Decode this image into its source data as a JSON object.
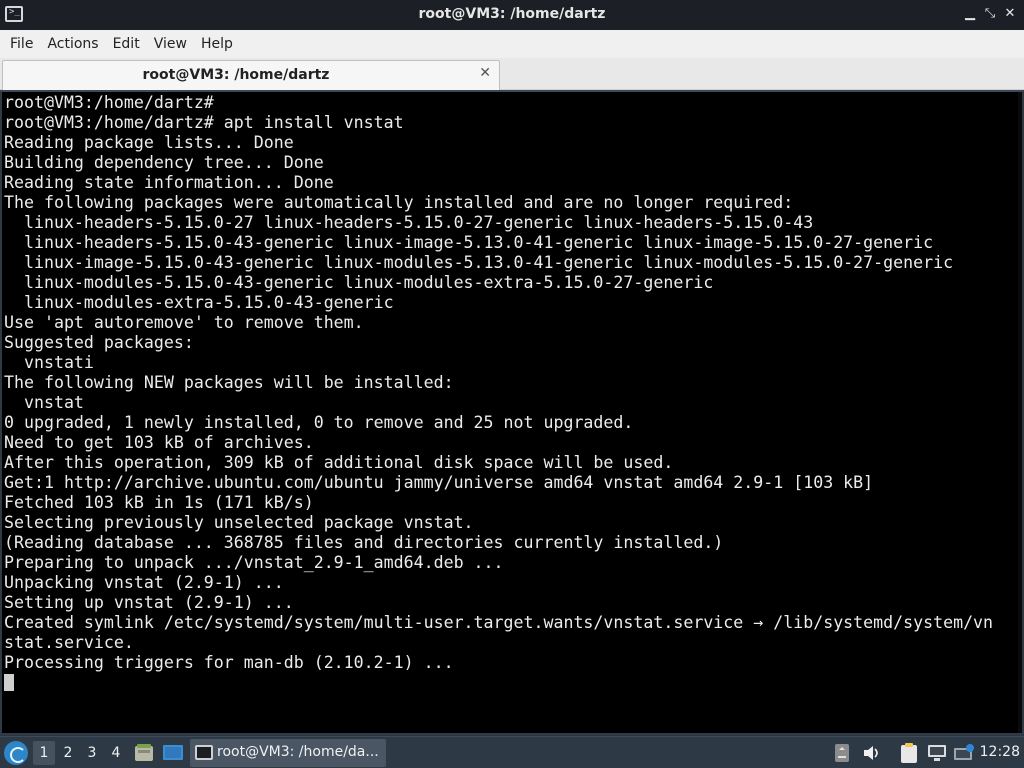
{
  "window": {
    "title": "root@VM3: /home/dartz",
    "minimize_glyph": "▁",
    "maximize_glyph": "⤡",
    "close_glyph": "✕"
  },
  "menu": [
    "File",
    "Actions",
    "Edit",
    "View",
    "Help"
  ],
  "tab": {
    "label": "root@VM3: /home/dartz",
    "close_glyph": "✕"
  },
  "terminal": {
    "lines": [
      "root@VM3:/home/dartz#",
      "root@VM3:/home/dartz# apt install vnstat",
      "Reading package lists... Done",
      "Building dependency tree... Done",
      "Reading state information... Done",
      "The following packages were automatically installed and are no longer required:",
      "  linux-headers-5.15.0-27 linux-headers-5.15.0-27-generic linux-headers-5.15.0-43",
      "  linux-headers-5.15.0-43-generic linux-image-5.13.0-41-generic linux-image-5.15.0-27-generic",
      "  linux-image-5.15.0-43-generic linux-modules-5.13.0-41-generic linux-modules-5.15.0-27-generic",
      "  linux-modules-5.15.0-43-generic linux-modules-extra-5.15.0-27-generic",
      "  linux-modules-extra-5.15.0-43-generic",
      "Use 'apt autoremove' to remove them.",
      "Suggested packages:",
      "  vnstati",
      "The following NEW packages will be installed:",
      "  vnstat",
      "0 upgraded, 1 newly installed, 0 to remove and 25 not upgraded.",
      "Need to get 103 kB of archives.",
      "After this operation, 309 kB of additional disk space will be used.",
      "Get:1 http://archive.ubuntu.com/ubuntu jammy/universe amd64 vnstat amd64 2.9-1 [103 kB]",
      "Fetched 103 kB in 1s (171 kB/s)",
      "Selecting previously unselected package vnstat.",
      "(Reading database ... 368785 files and directories currently installed.)",
      "Preparing to unpack .../vnstat_2.9-1_amd64.deb ...",
      "Unpacking vnstat (2.9-1) ...",
      "Setting up vnstat (2.9-1) ...",
      "Created symlink /etc/systemd/system/multi-user.target.wants/vnstat.service → /lib/systemd/system/vn",
      "stat.service.",
      "Processing triggers for man-db (2.10.2-1) ..."
    ]
  },
  "taskbar": {
    "workspaces": [
      "1",
      "2",
      "3",
      "4"
    ],
    "active_workspace": "1",
    "task_label": "root@VM3: /home/da...",
    "clock": "12:28"
  },
  "colors": {
    "terminal_bg": "#000000",
    "terminal_fg": "#ececec",
    "titlebar_bg": "#1c1f25",
    "taskbar_bg": "#2d3945"
  }
}
